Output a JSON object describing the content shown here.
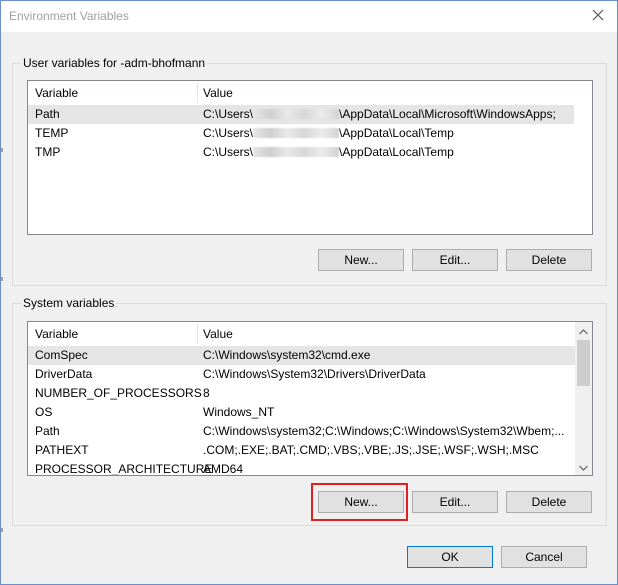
{
  "window": {
    "title": "Environment Variables"
  },
  "user": {
    "group_label": "User variables for -adm-bhofmann",
    "col_variable": "Variable",
    "col_value": "Value",
    "rows": [
      {
        "name": "Path",
        "value_prefix": "C:\\Users\\",
        "value_suffix": "\\AppData\\Local\\Microsoft\\WindowsApps;"
      },
      {
        "name": "TEMP",
        "value_prefix": "C:\\Users\\",
        "value_suffix": "\\AppData\\Local\\Temp"
      },
      {
        "name": "TMP",
        "value_prefix": "C:\\Users\\",
        "value_suffix": "\\AppData\\Local\\Temp"
      }
    ],
    "buttons": {
      "new": "New...",
      "edit": "Edit...",
      "delete": "Delete"
    }
  },
  "system": {
    "group_label": "System variables",
    "col_variable": "Variable",
    "col_value": "Value",
    "rows": [
      {
        "name": "ComSpec",
        "value": "C:\\Windows\\system32\\cmd.exe"
      },
      {
        "name": "DriverData",
        "value": "C:\\Windows\\System32\\Drivers\\DriverData"
      },
      {
        "name": "NUMBER_OF_PROCESSORS",
        "value": "8"
      },
      {
        "name": "OS",
        "value": "Windows_NT"
      },
      {
        "name": "Path",
        "value": "C:\\Windows\\system32;C:\\Windows;C:\\Windows\\System32\\Wbem;..."
      },
      {
        "name": "PATHEXT",
        "value": ".COM;.EXE;.BAT;.CMD;.VBS;.VBE;.JS;.JSE;.WSF;.WSH;.MSC"
      },
      {
        "name": "PROCESSOR_ARCHITECTURE",
        "value": "AMD64"
      }
    ],
    "buttons": {
      "new": "New...",
      "edit": "Edit...",
      "delete": "Delete"
    }
  },
  "footer": {
    "ok": "OK",
    "cancel": "Cancel"
  },
  "colors": {
    "highlight": "#e02020",
    "selected_row": "#e5e5e5",
    "ok_border": "#0078d7"
  },
  "icons": {
    "close": "close-icon",
    "scroll_up": "chevron-up-icon",
    "scroll_down": "chevron-down-icon"
  }
}
